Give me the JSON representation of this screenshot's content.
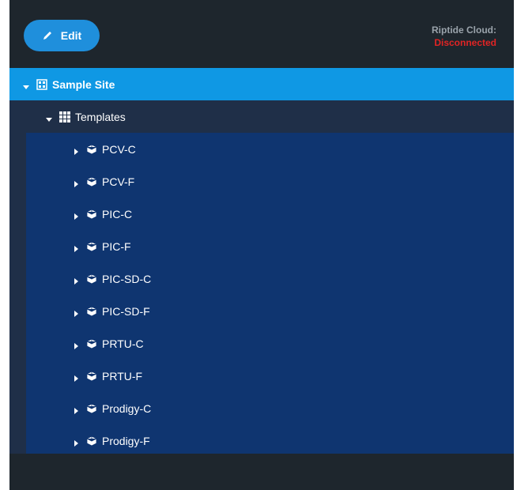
{
  "toolbar": {
    "edit_label": "Edit"
  },
  "cloud": {
    "label": "Riptide Cloud:",
    "status": "Disconnected",
    "status_color": "#e02424"
  },
  "tree": {
    "site": {
      "label": "Sample Site",
      "icon": "site-grid-icon",
      "expanded": true
    },
    "templates": {
      "label": "Templates",
      "icon": "table-grid-icon",
      "expanded": true
    },
    "items": [
      {
        "label": "PCV-C",
        "icon": "cube-icon"
      },
      {
        "label": "PCV-F",
        "icon": "cube-icon"
      },
      {
        "label": "PIC-C",
        "icon": "cube-icon"
      },
      {
        "label": "PIC-F",
        "icon": "cube-icon"
      },
      {
        "label": "PIC-SD-C",
        "icon": "cube-icon"
      },
      {
        "label": "PIC-SD-F",
        "icon": "cube-icon"
      },
      {
        "label": "PRTU-C",
        "icon": "cube-icon"
      },
      {
        "label": "PRTU-F",
        "icon": "cube-icon"
      },
      {
        "label": "Prodigy-C",
        "icon": "cube-icon"
      },
      {
        "label": "Prodigy-F",
        "icon": "cube-icon"
      }
    ]
  },
  "colors": {
    "accent": "#0f98e4",
    "button": "#1f8fdc",
    "background": "#1e262d",
    "templates_bg": "#1f2f48",
    "item_bg": "#0f3570"
  }
}
